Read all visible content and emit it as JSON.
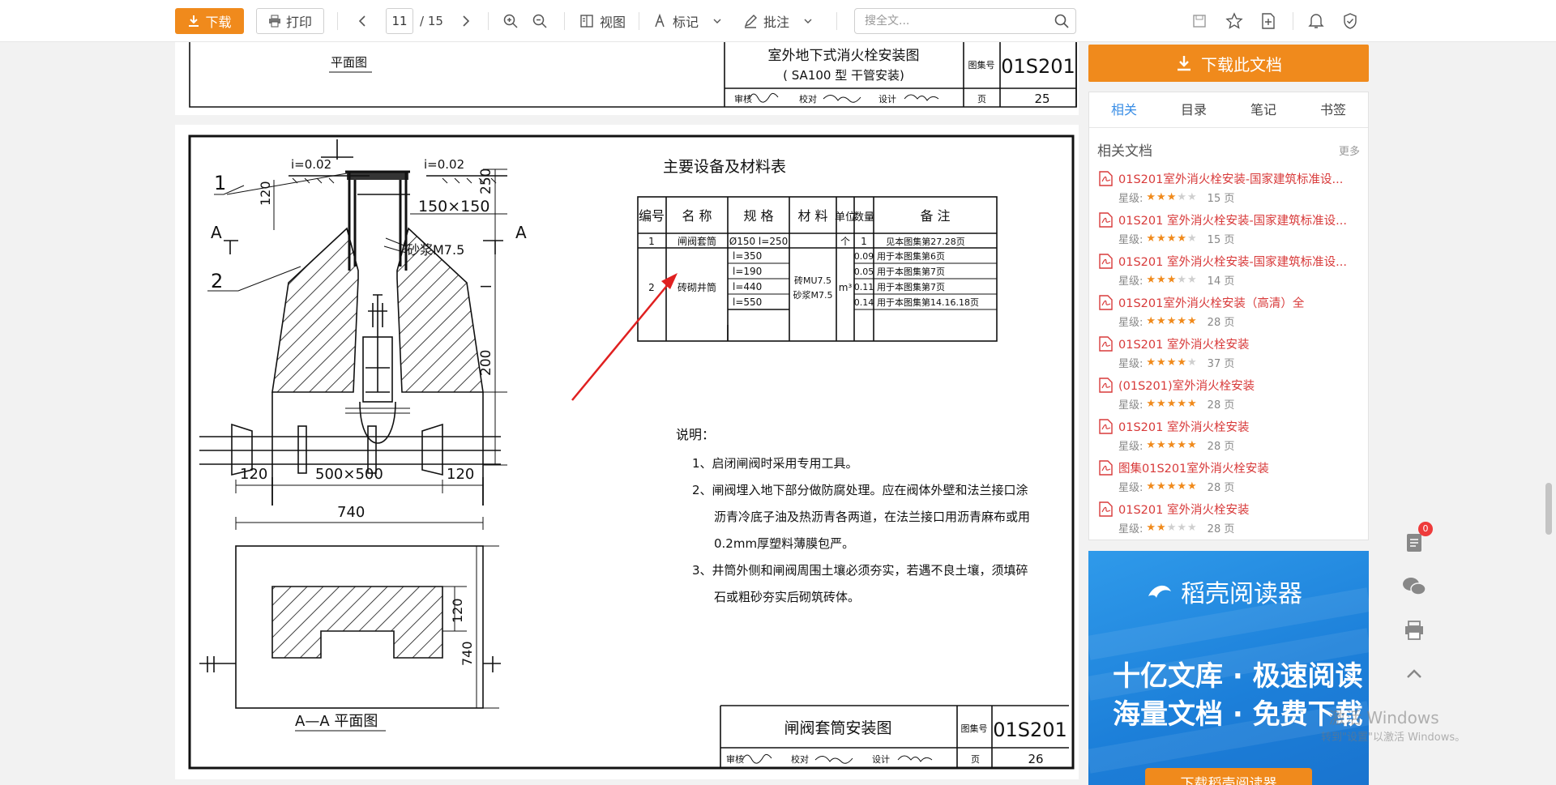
{
  "toolbar": {
    "download_label": "下载",
    "print_label": "打印",
    "page_current": "11",
    "page_total": "/ 15",
    "view_label": "视图",
    "mark_label": "标记",
    "annotate_label": "批注",
    "search_placeholder": "搜全文..."
  },
  "page_top": {
    "plan_label": "平面图",
    "title_line1": "室外地下式消火栓安装图",
    "title_line2": "( SA100 型 干管安装)",
    "atlas_label": "图集号",
    "atlas_no": "01S201",
    "review_label": "审核",
    "check_label": "校对",
    "design_label": "设计",
    "page_label": "页",
    "page_no": "25"
  },
  "drawing": {
    "slope_left": "i=0.02",
    "slope_right": "i=0.02",
    "callout_1": "1",
    "callout_2": "2",
    "dim_150x150": "150×150",
    "dim_120_top": "120",
    "dim_250": "250",
    "dim_l": "l",
    "dim_200": "200",
    "mortar": "砂浆M7.5",
    "section_a_left": "A",
    "section_a_right": "A",
    "dim_120_left": "120",
    "dim_500x500": "500×500",
    "dim_120_right": "120",
    "dim_740_top": "740",
    "dim_120_plan": "120",
    "dim_740_side": "740",
    "aa_plan": "A—A 平面图",
    "table_title": "主要设备及材料表",
    "table_headers": [
      "编号",
      "名 称",
      "规 格",
      "材 料",
      "单位",
      "数量",
      "备 注"
    ],
    "row1": {
      "no": "1",
      "name": "闸阀套筒",
      "spec": "Ø150 l=250",
      "unit": "个",
      "qty": "1",
      "note": "见本图集第27.28页"
    },
    "row2": {
      "no": "2",
      "name": "砖砌井筒",
      "material_1": "砖MU7.5",
      "material_2": "砂浆M7.5",
      "unit": "m³"
    },
    "row2_specs": [
      "l=350",
      "l=190",
      "l=440",
      "l=550"
    ],
    "row2_qty": [
      "0.09",
      "0.05",
      "0.11",
      "0.14"
    ],
    "row2_notes": [
      "用于本图集第6页",
      "用于本图集第7页",
      "用于本图集第7页",
      "用于本图集第14.16.18页"
    ],
    "notes_title": "说明：",
    "notes": [
      "1、启闭闸阀时采用专用工具。",
      "2、闸阀埋入地下部分做防腐处理。应在阀体外壁和法兰接口涂",
      "沥青冷底子油及热沥青各两道，在法兰接口用沥青麻布或用",
      "0.2mm厚塑料薄膜包严。",
      "3、井筒外侧和闸阀周围土壤必须夯实，若遇不良土壤，须填碎",
      "石或粗砂夯实后砌筑砖体。"
    ],
    "title_block_title": "闸阀套筒安装图",
    "atlas_label": "图集号",
    "atlas_no": "01S201",
    "review_label": "审核",
    "check_label": "校对",
    "design_label": "设计",
    "page_label": "页",
    "page_no": "26"
  },
  "sidebar": {
    "download_doc_label": "下载此文档",
    "tabs": [
      "相关",
      "目录",
      "笔记",
      "书签"
    ],
    "related_title": "相关文档",
    "more_label": "更多",
    "star_prefix": "星级:",
    "docs": [
      {
        "title": "01S201室外消火栓安装-国家建筑标准设...",
        "stars": 3,
        "pages": "15 页"
      },
      {
        "title": "01S201 室外消火栓安装-国家建筑标准设...",
        "stars": 4,
        "pages": "15 页"
      },
      {
        "title": "01S201 室外消火栓安装-国家建筑标准设...",
        "stars": 3,
        "pages": "14 页"
      },
      {
        "title": "01S201室外消火栓安装（高清）全",
        "stars": 5,
        "pages": "28 页"
      },
      {
        "title": "01S201 室外消火栓安装",
        "stars": 4,
        "pages": "37 页"
      },
      {
        "title": "(01S201)室外消火栓安装",
        "stars": 5,
        "pages": "28 页"
      },
      {
        "title": "01S201 室外消火栓安装",
        "stars": 5,
        "pages": "28 页"
      },
      {
        "title": "图集01S201室外消火栓安装",
        "stars": 5,
        "pages": "28 页"
      },
      {
        "title": "01S201 室外消火栓安装",
        "stars": 2,
        "pages": "28 页"
      }
    ],
    "ad": {
      "logo": "稻壳阅读器",
      "line1": "十亿文库 · 极速阅读",
      "line2": "海量文档 · 免费下载",
      "button": "下载稻壳阅读器"
    }
  },
  "floating": {
    "badge_count": "0"
  },
  "watermark": {
    "line1": "激活 Windows",
    "line2": "转到\"设置\"以激活 Windows。"
  },
  "colors": {
    "accent_orange": "#f08a1c",
    "tab_blue": "#3a8ee6",
    "doc_red": "#d83a3a",
    "ad_blue": "#1c7fd9"
  }
}
